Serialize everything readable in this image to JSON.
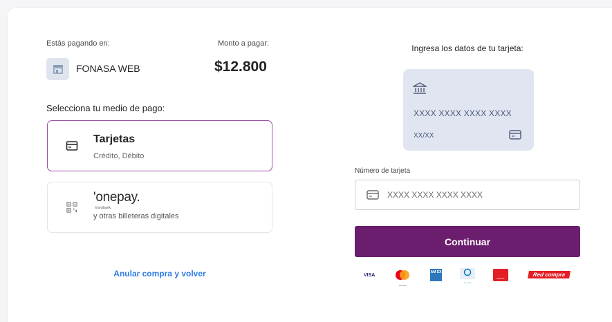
{
  "payment": {
    "paying_at_label": "Estás pagando en:",
    "merchant_name": "FONASA WEB",
    "amount_label": "Monto a pagar:",
    "amount": "$12.800",
    "select_method_label": "Selecciona tu medio de pago:"
  },
  "methods": {
    "cards": {
      "title": "Tarjetas",
      "subtitle": "Crédito, Débito",
      "selected": true
    },
    "onepay": {
      "logo_text": "'onepay.",
      "logo_sub": "transbank.",
      "description": "y otras billeteras digitales",
      "selected": false
    }
  },
  "cancel_link": "Anular compra y volver",
  "card_form": {
    "title": "Ingresa los datos de tu tarjeta:",
    "preview_number": "XXXX XXXX XXXX XXXX",
    "preview_expiry": "XX/XX",
    "number_label": "Número de tarjeta",
    "number_value": "",
    "number_placeholder": "XXXX XXXX XXXX XXXX",
    "continue_label": "Continuar"
  },
  "brand_logos": {
    "visa": "VISA",
    "mastercard": "mastercard",
    "amex": "AM EX",
    "diners": "Diners Club",
    "magna": "MAGNA",
    "redcompra": "Red compra"
  },
  "colors": {
    "accent": "#6b1d6e",
    "selected_border": "#9b4fa5",
    "link": "#2d7be5",
    "card_preview_bg": "#e0e5f1"
  },
  "icons": {
    "merchant": "store-icon",
    "cards": "credit-card-icon",
    "onepay": "qr-code-icon",
    "bank": "bank-icon"
  }
}
